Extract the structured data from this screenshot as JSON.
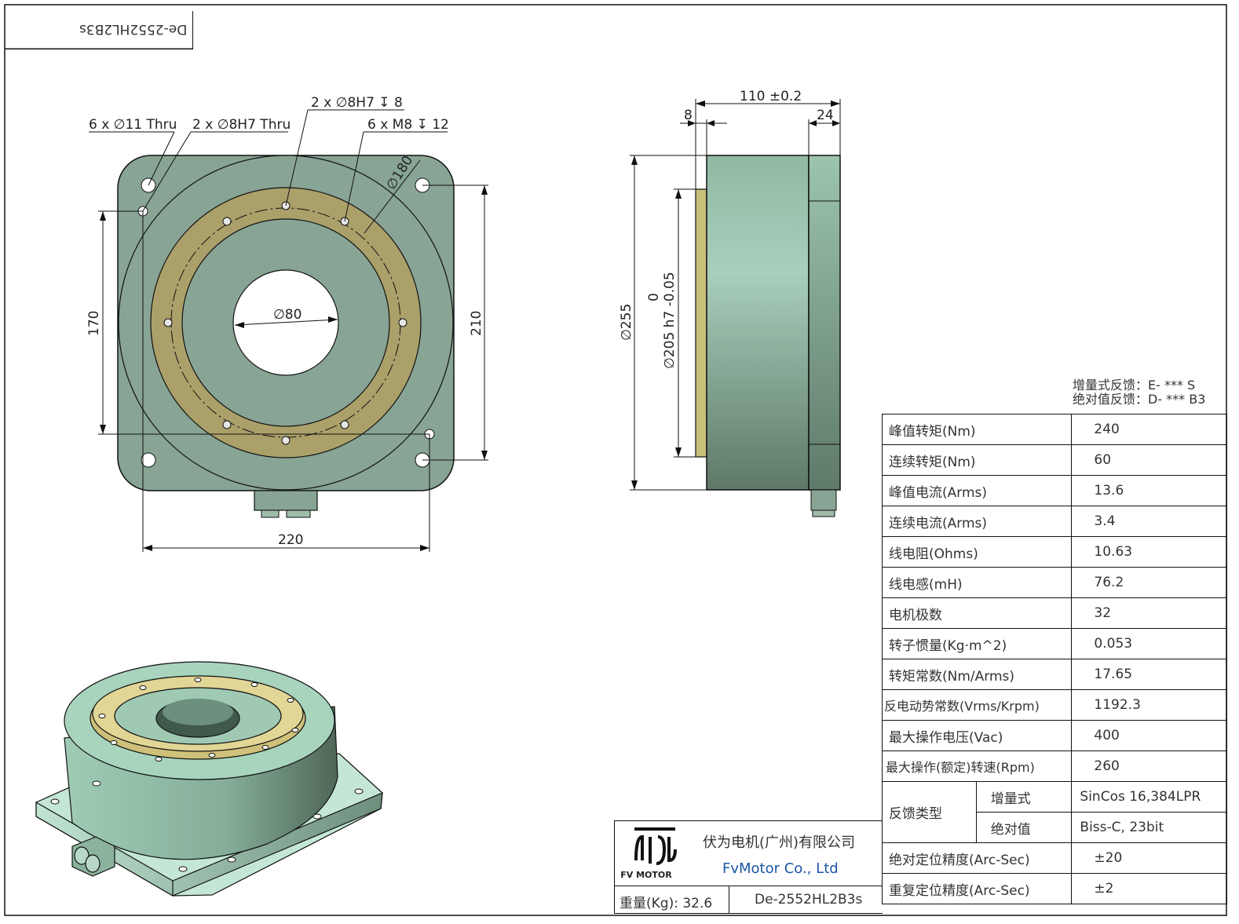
{
  "drawing_code": "De-2552HL2B3s",
  "front_view": {
    "callouts": [
      "6 x ∅11 Thru",
      "2 x ∅8H7 Thru",
      "2 x ∅8H7 ↧ 8",
      "6 x M8 ↧ 12"
    ],
    "dims": {
      "d180": "∅180",
      "d80": "∅80",
      "h170": "170",
      "h210": "210",
      "w220": "220"
    }
  },
  "side_view": {
    "dims": {
      "len110": "110 ±0.2",
      "t8": "8",
      "t24": "24",
      "d255": "∅255",
      "d205": "∅205 h7 -0.05",
      "d205_upper": "0"
    }
  },
  "feedback_note": {
    "incremental": "增量式反馈：E- *** S",
    "absolute": "绝对值反馈：D- *** B3"
  },
  "specs": [
    {
      "label": "峰值转矩(Nm)",
      "value": "240"
    },
    {
      "label": "连续转矩(Nm)",
      "value": "60"
    },
    {
      "label": "峰值电流(Arms)",
      "value": "13.6"
    },
    {
      "label": "连续电流(Arms)",
      "value": "3.4"
    },
    {
      "label": "线电阻(Ohms)",
      "value": "10.63"
    },
    {
      "label": "线电感(mH)",
      "value": "76.2"
    },
    {
      "label": "电机极数",
      "value": "32"
    },
    {
      "label": "转子惯量(Kg·m^2)",
      "value": "0.053"
    },
    {
      "label": "转矩常数(Nm/Arms)",
      "value": "17.65"
    },
    {
      "label": "反电动势常数(Vrms/Krpm)",
      "value": "1192.3"
    },
    {
      "label": "最大操作电压(Vac)",
      "value": "400"
    },
    {
      "label": "最大操作(额定)转速(Rpm)",
      "value": "260"
    }
  ],
  "feedback_type": {
    "label": "反馈类型",
    "incremental_label": "增量式",
    "incremental_value": "SinCos 16,384LPR",
    "absolute_label": "绝对值",
    "absolute_value": "Biss-C, 23bit"
  },
  "accuracy": [
    {
      "label": "绝对定位精度(Arc-Sec)",
      "value": "±20"
    },
    {
      "label": "重复定位精度(Arc-Sec)",
      "value": "±2"
    }
  ],
  "title_block": {
    "logo_text": "FV MOTOR",
    "company_cn": "伏为电机(广州)有限公司",
    "company_en": "FvMotor Co., Ltd",
    "weight_label": "重量(Kg):",
    "weight_value": "32.6",
    "model": "De-2552HL2B3s"
  }
}
